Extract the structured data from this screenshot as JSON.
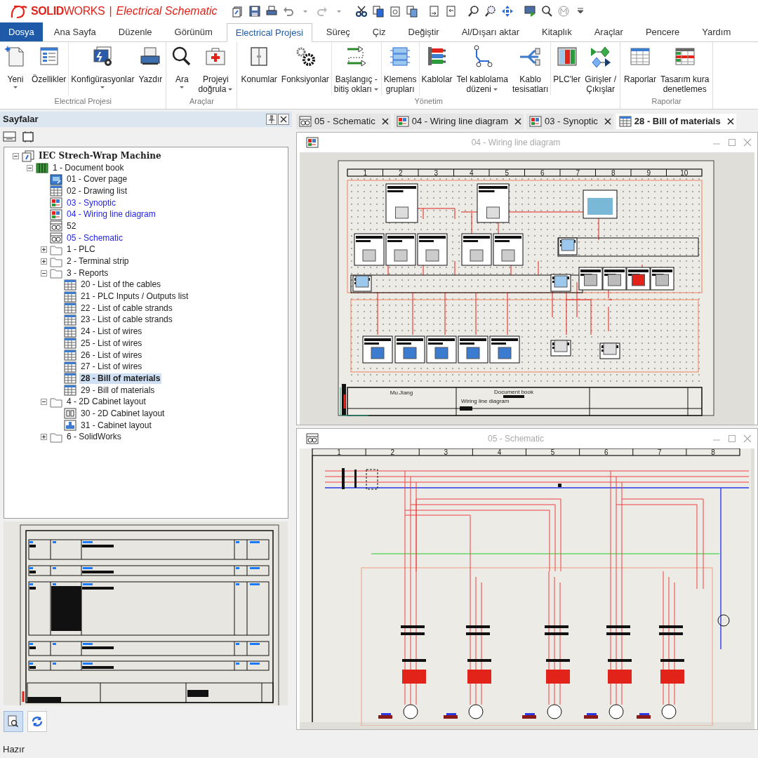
{
  "app_title": {
    "brand_bold": "SOLID",
    "brand_rest": "WORKS",
    "separator": "|",
    "product": "Electrical Schematic"
  },
  "menu_tabs": [
    {
      "label": "Dosya",
      "kind": "file",
      "selected": false
    },
    {
      "label": "Ana Sayfa",
      "kind": "tab",
      "selected": false
    },
    {
      "label": "Düzenle",
      "kind": "tab",
      "selected": false
    },
    {
      "label": "Görünüm",
      "kind": "tab",
      "selected": false
    },
    {
      "label": "Electrical Projesi",
      "kind": "tab",
      "selected": true
    },
    {
      "label": "Süreç",
      "kind": "tab",
      "selected": false
    },
    {
      "label": "Çiz",
      "kind": "tab",
      "selected": false
    },
    {
      "label": "Değiştir",
      "kind": "tab",
      "selected": false
    },
    {
      "label": "Al/Dışarı aktar",
      "kind": "tab",
      "selected": false
    },
    {
      "label": "Kitaplık",
      "kind": "tab",
      "selected": false
    },
    {
      "label": "Araçlar",
      "kind": "tab",
      "selected": false
    },
    {
      "label": "Pencere",
      "kind": "tab",
      "selected": false
    },
    {
      "label": "Yardım",
      "kind": "tab",
      "selected": false
    }
  ],
  "ribbon": {
    "groups": [
      {
        "label": "Electrical Projesi",
        "sections": [
          [
            {
              "lines": [
                "Yeni"
              ],
              "dropdown": true
            },
            {
              "lines": [
                "Özellikler"
              ],
              "dropdown": false
            }
          ],
          [
            {
              "lines": [
                "Konfigürasyonlar"
              ],
              "dropdown": true
            },
            {
              "lines": [
                "Yazdır"
              ],
              "dropdown": false
            }
          ]
        ]
      },
      {
        "label": "Araçlar",
        "sections": [
          [
            {
              "lines": [
                "Ara"
              ],
              "dropdown": true
            },
            {
              "lines": [
                "Projeyi",
                "doğrula"
              ],
              "dropdown": true
            }
          ]
        ]
      },
      {
        "label": "Yönetim",
        "sections": [
          [
            {
              "lines": [
                "Konumlar"
              ],
              "dropdown": false
            },
            {
              "lines": [
                "Fonksiyonlar"
              ],
              "dropdown": false
            }
          ],
          [
            {
              "lines": [
                "Başlangıç -",
                "bitiş okları"
              ],
              "dropdown": true
            }
          ],
          [
            {
              "lines": [
                "Klemens",
                "grupları"
              ],
              "dropdown": false
            }
          ],
          [
            {
              "lines": [
                "Kablolar"
              ],
              "dropdown": false
            },
            {
              "lines": [
                "Tel kablolama",
                "düzeni"
              ],
              "dropdown": true
            },
            {
              "lines": [
                "Kablo",
                "tesisatları"
              ],
              "dropdown": false
            }
          ],
          [
            {
              "lines": [
                "PLC'ler"
              ],
              "dropdown": false
            },
            {
              "lines": [
                "Girişler /",
                "Çıkışlar"
              ],
              "dropdown": false
            }
          ]
        ]
      },
      {
        "label": "Raporlar",
        "sections": [
          [
            {
              "lines": [
                "Raporlar"
              ],
              "dropdown": false
            },
            {
              "lines": [
                "Tasarım kura",
                "denetlemes"
              ],
              "dropdown": false
            }
          ]
        ]
      }
    ]
  },
  "pages_panel": {
    "title": "Sayfalar",
    "tree": [
      {
        "label": "IEC Strech-Wrap Machine",
        "kind": "project",
        "expanded": true,
        "selected": false,
        "children": [
          {
            "label": "1 - Document book",
            "kind": "book",
            "expanded": true,
            "selected": false,
            "children": [
              {
                "label": "01 - Cover page",
                "kind": "cover",
                "open": false,
                "selected": false
              },
              {
                "label": "02 - Drawing list",
                "kind": "list",
                "open": false,
                "selected": false
              },
              {
                "label": "03 - Synoptic",
                "kind": "synoptic",
                "open": true,
                "selected": false
              },
              {
                "label": "04 - Wiring line diagram",
                "kind": "synoptic",
                "open": true,
                "selected": false
              },
              {
                "label": "52",
                "kind": "schematic",
                "open": false,
                "selected": false
              },
              {
                "label": "05 - Schematic",
                "kind": "schematic",
                "open": true,
                "selected": false
              },
              {
                "label": "1 - PLC",
                "kind": "folder",
                "expanded": false,
                "selected": false
              },
              {
                "label": "2 - Terminal strip",
                "kind": "folder",
                "expanded": false,
                "selected": false
              },
              {
                "label": "3 - Reports",
                "kind": "folder",
                "expanded": true,
                "selected": false,
                "children": [
                  {
                    "label": "20 - List of the cables",
                    "kind": "list",
                    "open": false,
                    "selected": false
                  },
                  {
                    "label": "21 - PLC Inputs / Outputs list",
                    "kind": "list",
                    "open": false,
                    "selected": false
                  },
                  {
                    "label": "22 - List of cable strands",
                    "kind": "list",
                    "open": false,
                    "selected": false
                  },
                  {
                    "label": "23 - List of cable strands",
                    "kind": "list",
                    "open": false,
                    "selected": false
                  },
                  {
                    "label": "24 - List of wires",
                    "kind": "list",
                    "open": false,
                    "selected": false
                  },
                  {
                    "label": "25 - List of wires",
                    "kind": "list",
                    "open": false,
                    "selected": false
                  },
                  {
                    "label": "26 - List of wires",
                    "kind": "list",
                    "open": false,
                    "selected": false
                  },
                  {
                    "label": "27 - List of wires",
                    "kind": "list",
                    "open": false,
                    "selected": false
                  },
                  {
                    "label": "28 - Bill of materials",
                    "kind": "list",
                    "open": false,
                    "selected": true
                  },
                  {
                    "label": "29 - Bill of materials",
                    "kind": "list",
                    "open": false,
                    "selected": false
                  }
                ]
              },
              {
                "label": "4 - 2D Cabinet layout",
                "kind": "folder",
                "expanded": true,
                "selected": false,
                "children": [
                  {
                    "label": "30 - 2D Cabinet layout",
                    "kind": "cabinet2d",
                    "open": false,
                    "selected": false
                  },
                  {
                    "label": "31 - Cabinet layout",
                    "kind": "cabinet",
                    "open": false,
                    "selected": false
                  }
                ]
              },
              {
                "label": "6 - SolidWorks",
                "kind": "folder",
                "expanded": false,
                "selected": false
              }
            ]
          }
        ]
      }
    ],
    "preview_buttons": [
      {
        "selected": true
      },
      {
        "selected": false
      }
    ]
  },
  "document_tabs": [
    {
      "label": "05 - Schematic",
      "kind": "schematic",
      "selected": false
    },
    {
      "label": "04 - Wiring line diagram",
      "kind": "synoptic",
      "selected": false
    },
    {
      "label": "03 - Synoptic",
      "kind": "synoptic",
      "selected": false
    },
    {
      "label": "28 - Bill of materials",
      "kind": "list",
      "selected": true
    }
  ],
  "windows": [
    {
      "title": "04 - Wiring line diagram",
      "kind": "wiring",
      "columns": [
        "1",
        "2",
        "3",
        "4",
        "5",
        "6",
        "7",
        "8",
        "9",
        "10"
      ],
      "title_block": [
        "Mu.Jiang",
        "Document book",
        "Wiring line diagram"
      ]
    },
    {
      "title": "05 - Schematic",
      "kind": "schematic",
      "columns": [
        "1",
        "2",
        "3",
        "4",
        "5",
        "6",
        "7",
        "8"
      ]
    }
  ],
  "status_bar": "Hazır"
}
